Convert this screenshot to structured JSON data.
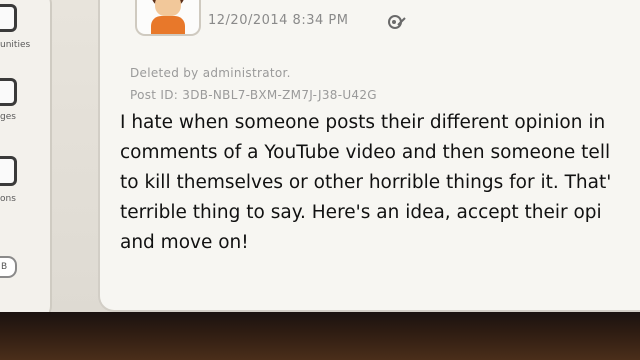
{
  "sidebar": {
    "items": [
      {
        "label": "unities",
        "icon": "communities-icon"
      },
      {
        "label": "ges",
        "icon": "messages-icon"
      },
      {
        "label": "ons",
        "icon": "notifications-icon"
      }
    ],
    "badge": "B"
  },
  "post": {
    "timestamp": "12/20/2014 8:34 PM",
    "status": "Deleted by administrator.",
    "post_id": "Post ID: 3DB-NBL7-BXM-ZM7J-J38-U42G",
    "body_lines": [
      "I hate when someone posts their different opinion in",
      "comments of a YouTube video and then someone tell",
      "to kill themselves or other horrible things for it. That'",
      "terrible thing to say. Here's an idea, accept their opi",
      "and move on!"
    ]
  }
}
